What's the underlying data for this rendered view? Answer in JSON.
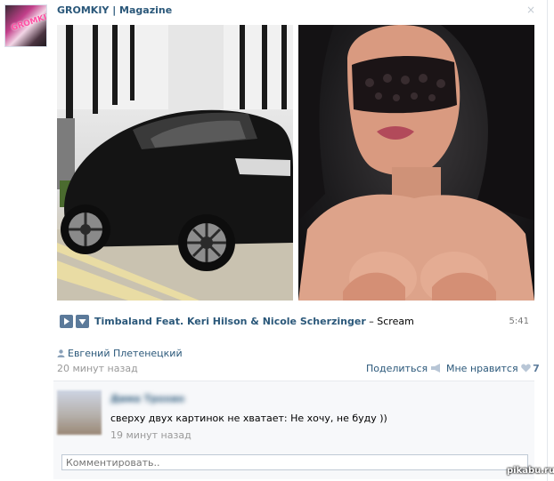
{
  "post": {
    "author": "GROMKIY | Magazine",
    "close": "×",
    "avatar_text": "GROMKIY"
  },
  "audio": {
    "artist": "Timbaland Feat. Keri Hilson & Nicole Scherzinger",
    "separator": " – ",
    "title": "Scream",
    "duration": "5:41"
  },
  "meta": {
    "poster": "Евгений Плетенецкий",
    "time": "20 минут назад",
    "share_label": "Поделиться",
    "like_label": "Мне нравится",
    "like_count": "7"
  },
  "comment": {
    "name": "Дима Трохин",
    "text": "сверху двух картинок не хватает: Не хочу, не буду ))",
    "time": "19 минут назад",
    "input_placeholder": "Комментировать.."
  },
  "watermark": "pikabu.ru",
  "colors": {
    "link": "#2b587a",
    "muted": "#999999",
    "button": "#5b7a9a"
  }
}
